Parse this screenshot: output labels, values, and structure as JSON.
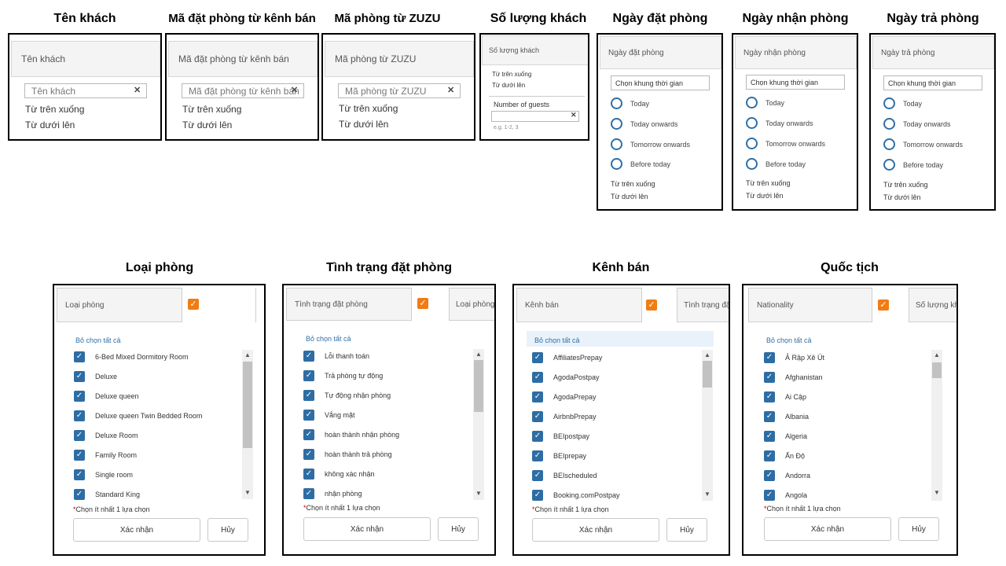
{
  "common": {
    "sort_asc": "Từ trên xuống",
    "sort_desc": "Từ dưới lên",
    "clear_icon": "x-icon",
    "check_icon": "checkmark-icon",
    "deselect_all": "Bỏ chọn tất cả",
    "required_note": "Chọn ít nhất 1 lựa chọn",
    "required_star": "*",
    "confirm": "Xác nhận",
    "cancel": "Hủy",
    "date_range_placeholder": "Chọn khung thời gian",
    "date_options": [
      "Today",
      "Today onwards",
      "Tomorrow onwards",
      "Before today"
    ]
  },
  "guest_name": {
    "caption": "Tên khách",
    "header": "Tên khách",
    "input_value": "Tên khách"
  },
  "booking_code": {
    "caption": "Mã đặt phòng từ kênh bán",
    "header": "Mã đặt phòng từ kênh bán",
    "input_value": "Mã đặt phòng từ kênh bán"
  },
  "room_code": {
    "caption": "Mã phòng từ ZUZU",
    "header": "Mã phòng từ ZUZU",
    "input_value": "Mã phòng từ ZUZU"
  },
  "guest_count": {
    "caption": "Số lượng khách",
    "header": "Số lượng khách",
    "label": "Number of guests",
    "hint": "e.g. 1-2, 3"
  },
  "booking_date": {
    "caption": "Ngày đặt phòng",
    "header": "Ngày đặt phòng"
  },
  "checkin_date": {
    "caption": "Ngày nhận phòng",
    "header": "Ngày nhận phòng"
  },
  "checkout_date": {
    "caption": "Ngày trả phòng",
    "header": "Ngày trả phòng"
  },
  "room_type": {
    "caption": "Loại phòng",
    "header": "Loại phòng",
    "items": [
      "6-Bed Mixed Dormitory Room",
      "Deluxe",
      "Deluxe queen",
      "Deluxe queen Twin Bedded Room",
      "Deluxe Room",
      "Family Room",
      "Single room",
      "Standard King"
    ]
  },
  "booking_status": {
    "caption": "Tình trạng đặt phòng",
    "header": "Tình trạng đặt phòng",
    "next_header": "Loại phòng",
    "items": [
      "Lỗi thanh toán",
      "Trả phòng tự động",
      "Tự động nhận phòng",
      "Vắng mặt",
      "hoàn thành nhận phòng",
      "hoàn thành trả phòng",
      "không xác nhận",
      "nhận phòng"
    ]
  },
  "sales_channel": {
    "caption": "Kênh bán",
    "header": "Kênh bán",
    "next_header": "Tình trạng đặt phòng",
    "items": [
      "AffiliatesPrepay",
      "AgodaPostpay",
      "AgodaPrepay",
      "AirbnbPrepay",
      "BEIpostpay",
      "BEIprepay",
      "BEIscheduled",
      "Booking.comPostpay"
    ]
  },
  "nationality": {
    "caption": "Quốc tịch",
    "header": "Nationality",
    "next_header": "Số lượng khách",
    "items": [
      "Ả Rập Xê Út",
      "Afghanistan",
      "Ai Cập",
      "Albania",
      "Algeria",
      "Ấn Độ",
      "Andorra",
      "Angola"
    ]
  },
  "colors": {
    "checkbox_blue": "#2e6da4",
    "accent_orange": "#f07c14",
    "link_blue": "#2f6fa6"
  }
}
